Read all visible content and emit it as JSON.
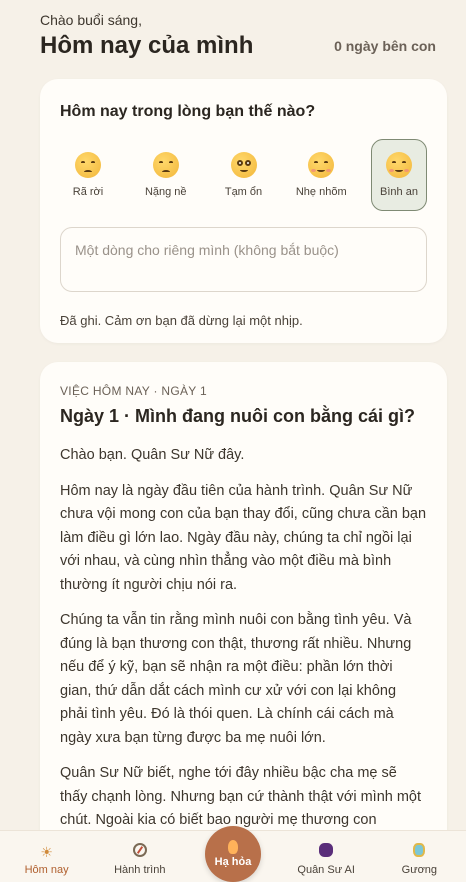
{
  "header": {
    "greeting": "Chào buổi sáng,",
    "title": "Hôm nay của mình",
    "streak": "0 ngày bên con"
  },
  "mood": {
    "question": "Hôm nay trong lòng bạn thế nào?",
    "options": [
      {
        "label": "Rã rời",
        "icon": "sad-face-icon"
      },
      {
        "label": "Nặng nề",
        "icon": "pensive-face-icon"
      },
      {
        "label": "Tạm ổn",
        "icon": "wide-eyed-face-icon"
      },
      {
        "label": "Nhẹ nhõm",
        "icon": "relieved-face-icon"
      },
      {
        "label": "Bình an",
        "icon": "peaceful-face-icon"
      }
    ],
    "selected": "Bình an",
    "note_placeholder": "Một dòng cho riêng mình (không bắt buộc)",
    "note_value": "",
    "saved_text": "Đã ghi. Cảm ơn bạn đã dừng lại một nhịp."
  },
  "lesson": {
    "eyebrow": "VIỆC HÔM NAY · NGÀY 1",
    "title": "Ngày 1 · Mình đang nuôi con bằng cái gì?",
    "paragraphs": [
      "Chào bạn. Quân Sư Nữ đây.",
      "Hôm nay là ngày đầu tiên của hành trình. Quân Sư Nữ chưa vội mong con của bạn thay đổi, cũng chưa cần bạn làm điều gì lớn lao. Ngày đầu này, chúng ta chỉ ngồi lại với nhau, và cùng nhìn thẳng vào một điều mà bình thường ít người chịu nói ra.",
      "Chúng ta vẫn tin rằng mình nuôi con bằng tình yêu. Và đúng là bạn thương con thật, thương rất nhiều. Nhưng nếu để ý kỹ, bạn sẽ nhận ra một điều: phần lớn thời gian, thứ dẫn dắt cách mình cư xử với con lại không phải tình yêu. Đó là thói quen. Là chính cái cách mà ngày xưa bạn từng được ba mẹ nuôi lớn.",
      "Quân Sư Nữ biết, nghe tới đây nhiều bậc cha mẹ sẽ thấy chạnh lòng. Nhưng bạn cứ thành thật với mình một chút. Ngoài kia có biết bao người mẹ thương con"
    ]
  },
  "nav": {
    "items": [
      {
        "label": "Hôm nay",
        "icon": "sun-icon"
      },
      {
        "label": "Hành trình",
        "icon": "compass-icon"
      },
      {
        "label": "Hạ hỏa",
        "icon": "flame-icon"
      },
      {
        "label": "Quân Sư AI",
        "icon": "grape-icon"
      },
      {
        "label": "Gương",
        "icon": "mirror-gem-icon"
      }
    ],
    "active": "Hôm nay"
  },
  "colors": {
    "background": "#f6f1e8",
    "card": "#fffdf9",
    "accent": "#b8704a",
    "selected_mood_bg": "#e8ece2"
  }
}
